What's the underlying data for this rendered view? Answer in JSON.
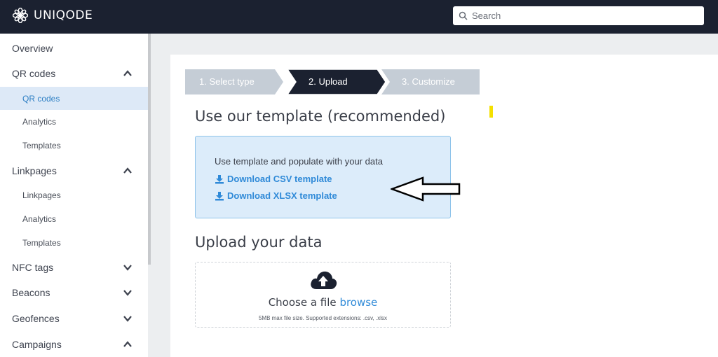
{
  "brand": {
    "name": "UNIQODE"
  },
  "search": {
    "placeholder": "Search"
  },
  "sidebar": {
    "overview": "Overview",
    "qr_codes": {
      "label": "QR codes",
      "items": [
        "QR codes",
        "Analytics",
        "Templates"
      ],
      "active": "QR codes"
    },
    "linkpages": {
      "label": "Linkpages",
      "items": [
        "Linkpages",
        "Analytics",
        "Templates"
      ]
    },
    "nfc_tags": "NFC tags",
    "beacons": "Beacons",
    "geofences": "Geofences",
    "campaigns": "Campaigns"
  },
  "stepper": {
    "steps": [
      "1. Select type",
      "2. Upload",
      "3. Customize"
    ],
    "active_index": 1
  },
  "template_section": {
    "title": "Use our template (recommended)",
    "description": "Use template and populate with your data",
    "csv_link": "Download CSV template",
    "xlsx_link": "Download XLSX template"
  },
  "upload_section": {
    "title": "Upload your data",
    "choose_text": "Choose a file",
    "browse_text": "browse",
    "hint": "5MB max file size. Supported extensions: .csv, .xlsx"
  },
  "colors": {
    "topbar": "#1b2130",
    "accent": "#2f8ad8",
    "step_active": "#1b2130",
    "step_inactive": "#c5cdd6",
    "template_bg": "#dcecfa"
  }
}
